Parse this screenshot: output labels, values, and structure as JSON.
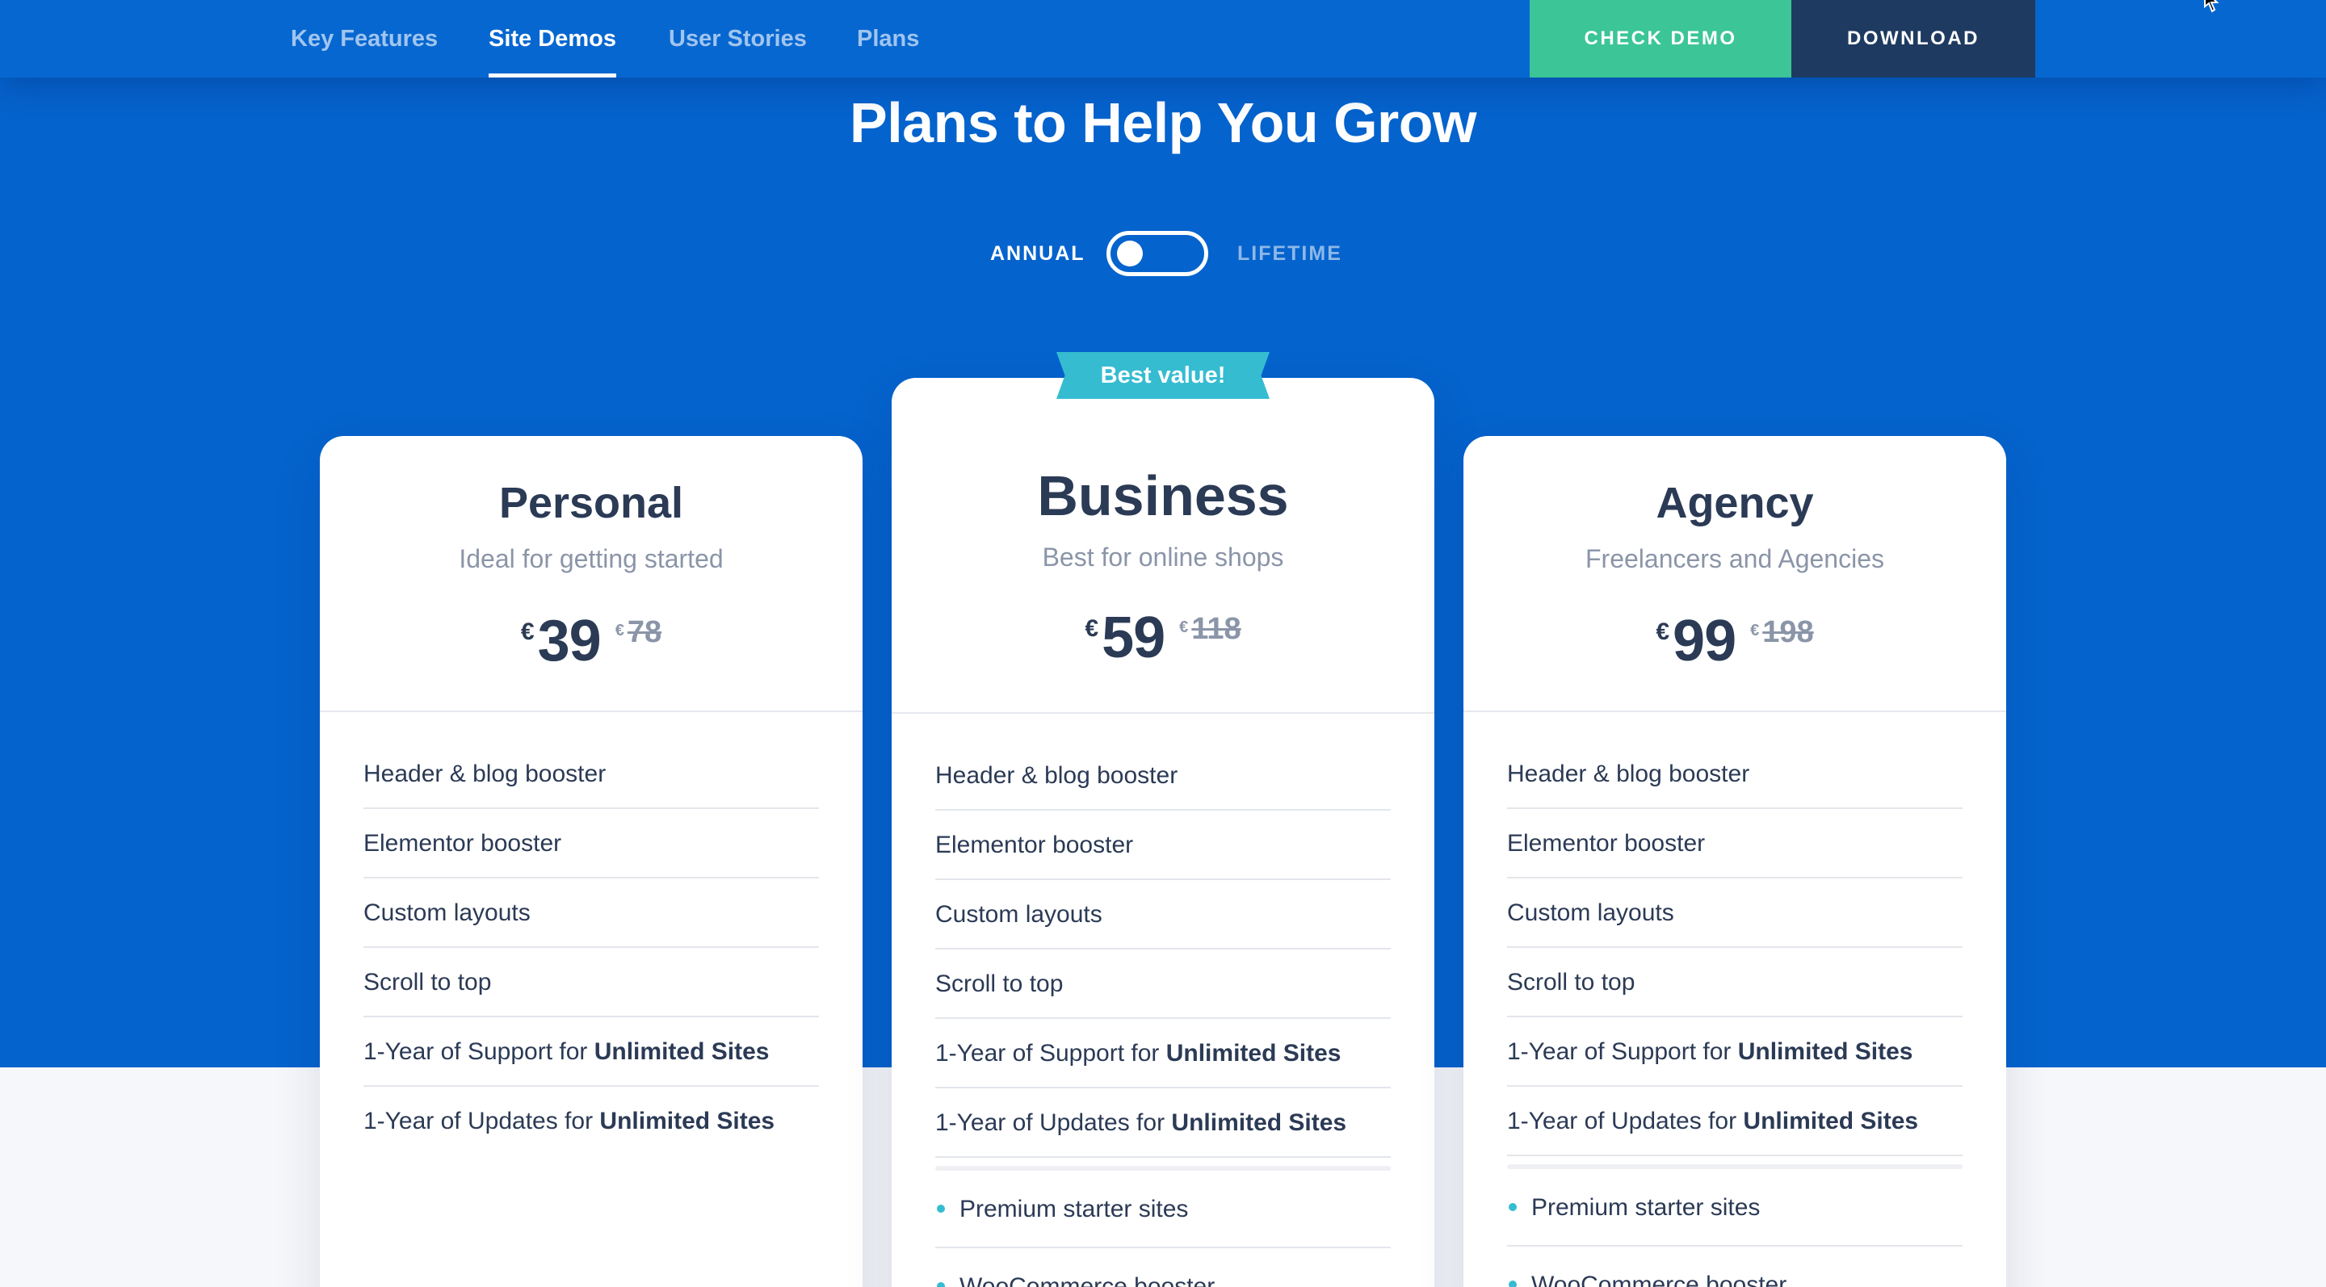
{
  "nav": {
    "links": [
      "Key Features",
      "Site Demos",
      "User Stories",
      "Plans"
    ],
    "active_index": 1,
    "check_demo": "CHECK DEMO",
    "download": "DOWNLOAD"
  },
  "section": {
    "title": "Plans to Help You Grow"
  },
  "billing_toggle": {
    "annual": "ANNUAL",
    "lifetime": "LIFETIME",
    "selected": "annual"
  },
  "plans": [
    {
      "name": "Personal",
      "subtitle": "Ideal for getting started",
      "currency": "€",
      "price": "39",
      "old_currency": "€",
      "old_price": "78",
      "features": [
        {
          "text": "Header & blog booster",
          "bold": ""
        },
        {
          "text": "Elementor booster",
          "bold": ""
        },
        {
          "text": "Custom layouts",
          "bold": ""
        },
        {
          "text": "Scroll to top",
          "bold": ""
        },
        {
          "text": "1-Year of Support for ",
          "bold": "Unlimited Sites"
        },
        {
          "text": "1-Year of Updates for ",
          "bold": "Unlimited Sites"
        }
      ],
      "extras": []
    },
    {
      "name": "Business",
      "badge": "Best value!",
      "subtitle": "Best for online shops",
      "currency": "€",
      "price": "59",
      "old_currency": "€",
      "old_price": "118",
      "features": [
        {
          "text": "Header & blog booster",
          "bold": ""
        },
        {
          "text": "Elementor booster",
          "bold": ""
        },
        {
          "text": "Custom layouts",
          "bold": ""
        },
        {
          "text": "Scroll to top",
          "bold": ""
        },
        {
          "text": "1-Year of Support for ",
          "bold": "Unlimited Sites"
        },
        {
          "text": "1-Year of Updates for ",
          "bold": "Unlimited Sites"
        }
      ],
      "extras": [
        "Premium starter sites",
        "WooCommerce booster"
      ]
    },
    {
      "name": "Agency",
      "subtitle": "Freelancers and Agencies",
      "currency": "€",
      "price": "99",
      "old_currency": "€",
      "old_price": "198",
      "features": [
        {
          "text": "Header & blog booster",
          "bold": ""
        },
        {
          "text": "Elementor booster",
          "bold": ""
        },
        {
          "text": "Custom layouts",
          "bold": ""
        },
        {
          "text": "Scroll to top",
          "bold": ""
        },
        {
          "text": "1-Year of Support for ",
          "bold": "Unlimited Sites"
        },
        {
          "text": "1-Year of Updates for ",
          "bold": "Unlimited Sites"
        }
      ],
      "extras": [
        "Premium starter sites",
        "WooCommerce booster"
      ]
    }
  ],
  "colors": {
    "primary_blue": "#0563cd",
    "nav_blue": "#0767d1",
    "demo_green": "#3cc596",
    "download_navy": "#1f3a61",
    "ribbon_teal": "#35bcd1",
    "text_dark": "#2b3a55",
    "text_muted": "#8b95a8"
  }
}
